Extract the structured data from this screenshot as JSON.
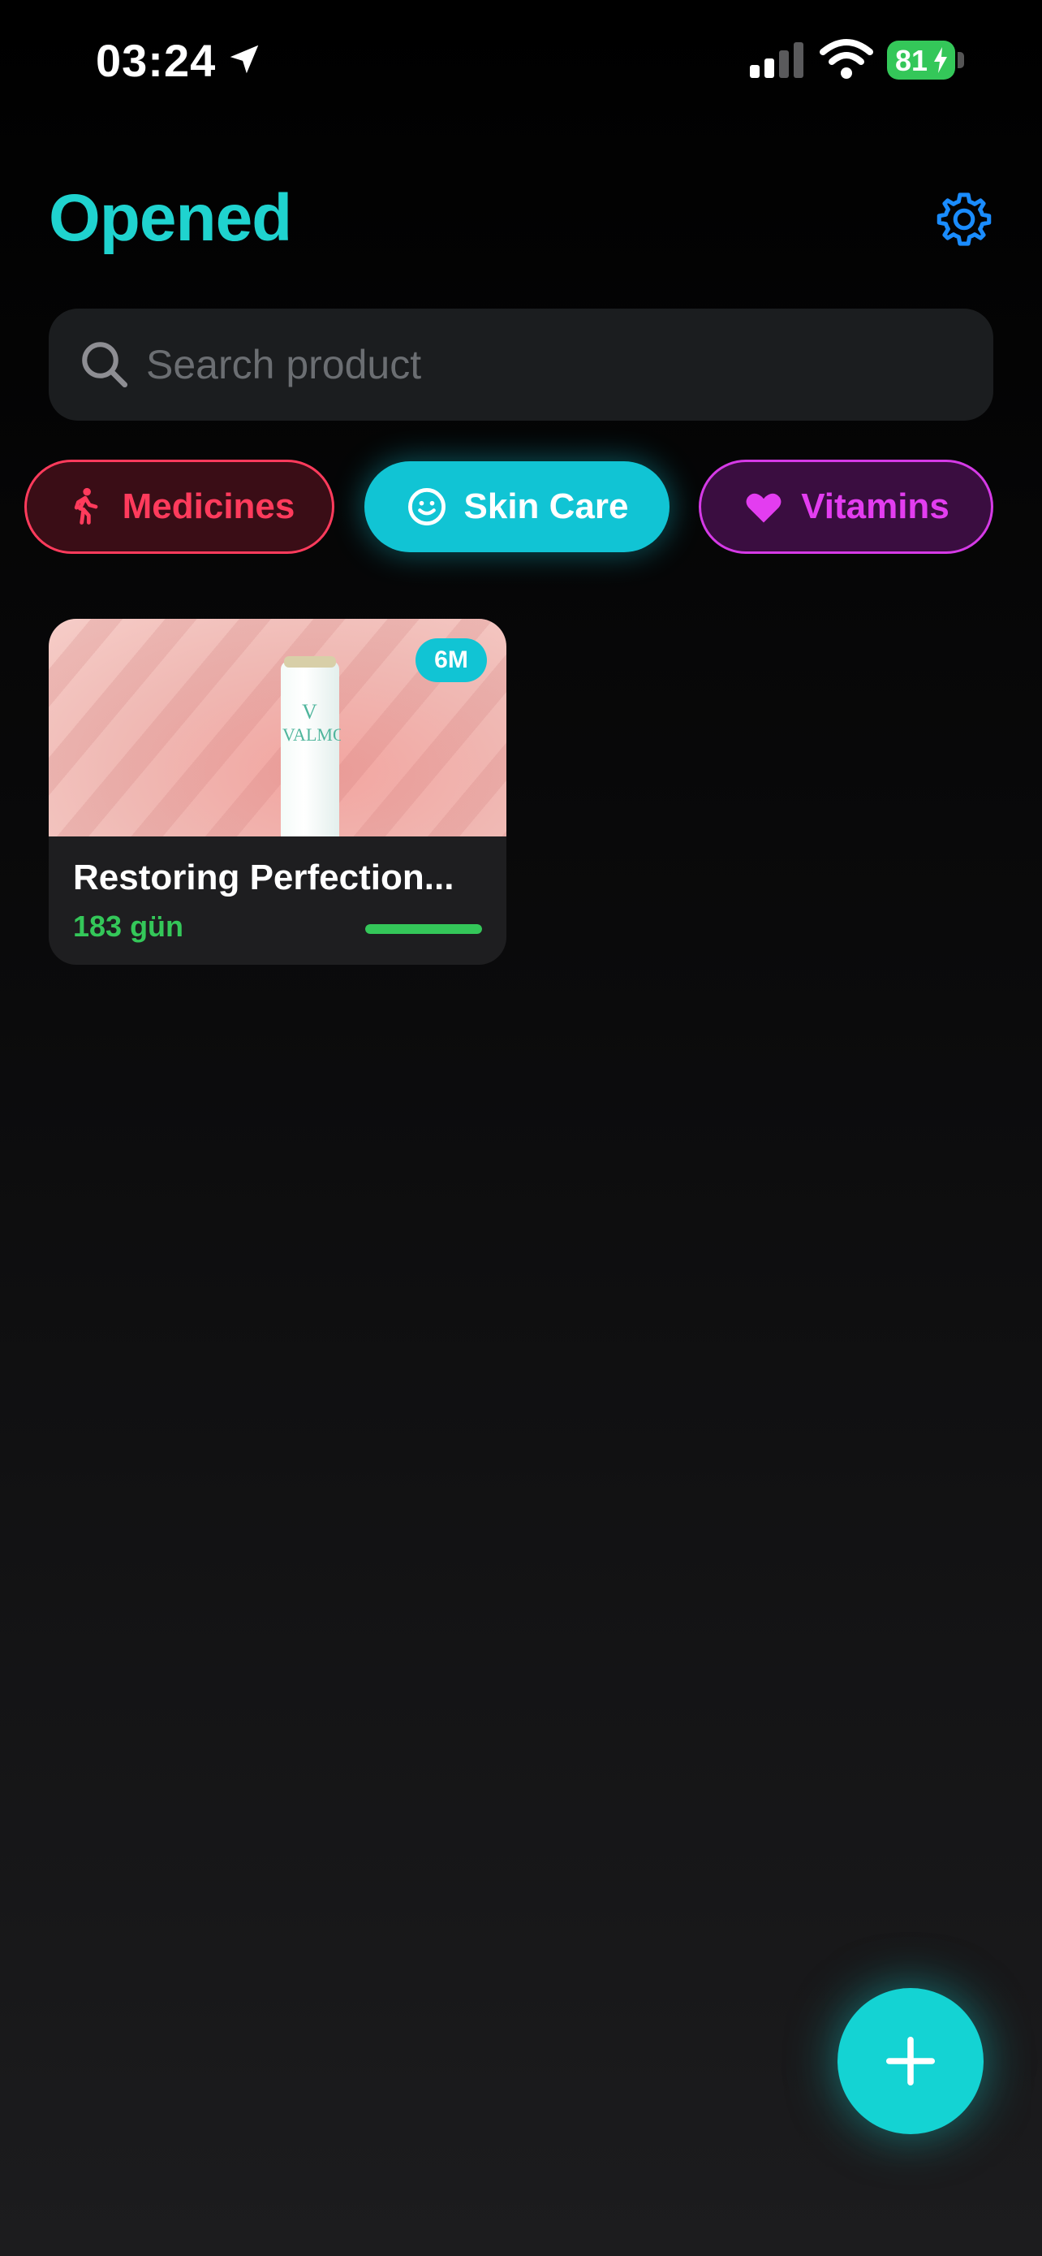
{
  "status_bar": {
    "time": "03:24",
    "battery_level": "81",
    "battery_color": "#34c759",
    "icons": [
      "location-arrow-icon",
      "cellular-signal-icon",
      "wifi-icon",
      "battery-charging-icon"
    ]
  },
  "header": {
    "title": "Opened",
    "title_color": "#1fd3cf",
    "settings_icon": "gear-icon",
    "settings_color": "#1a8cff"
  },
  "search": {
    "placeholder": "Search product",
    "value": "",
    "icon": "search-icon"
  },
  "categories": [
    {
      "label": "Medicines",
      "icon": "person-walking-icon",
      "color": "#ff3b5c",
      "selected": false
    },
    {
      "label": "Skin Care",
      "icon": "smiley-face-icon",
      "color": "#11c4d4",
      "selected": true
    },
    {
      "label": "Vitamins",
      "icon": "heart-icon",
      "color": "#e33df0",
      "selected": false
    }
  ],
  "products": [
    {
      "name": "Restoring Perfection...",
      "days_label": "183 gün",
      "duration_badge": "6M",
      "progress": 1.0,
      "progress_color": "#34c759",
      "image_brand_text": "VALMONT"
    }
  ],
  "fab": {
    "icon": "plus-icon",
    "color": "#14d3d3"
  }
}
